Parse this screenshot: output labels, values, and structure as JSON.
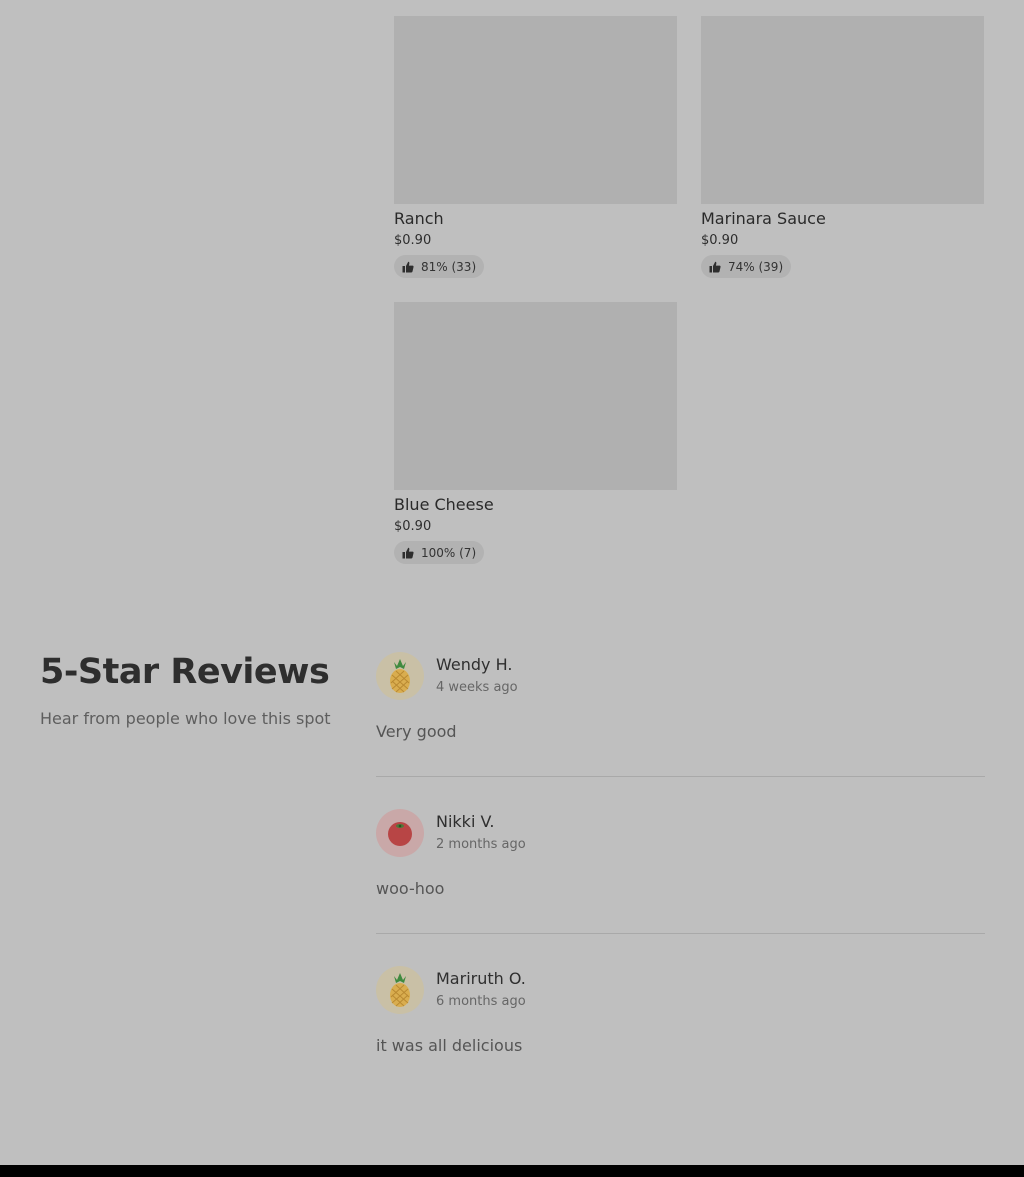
{
  "items": [
    {
      "name": "Ranch",
      "price": "$0.90",
      "rating": "81% (33)"
    },
    {
      "name": "Marinara Sauce",
      "price": "$0.90",
      "rating": "74% (39)"
    },
    {
      "name": "Blue Cheese",
      "price": "$0.90",
      "rating": "100% (7)"
    }
  ],
  "reviews_section": {
    "title": "5-Star Reviews",
    "subtitle": "Hear from people who love this spot"
  },
  "reviews": [
    {
      "name": "Wendy H.",
      "time": "4 weeks ago",
      "text": "Very good",
      "avatar_icon": "pineapple-icon"
    },
    {
      "name": "Nikki V.",
      "time": "2 months ago",
      "text": "woo-hoo",
      "avatar_icon": "tomato-icon"
    },
    {
      "name": "Mariruth O.",
      "time": "6 months ago",
      "text": "it was all delicious",
      "avatar_icon": "pineapple-icon"
    }
  ],
  "colors": {
    "background": "#bfbfbf",
    "image_placeholder": "#b0b0b0",
    "footer": "#000000"
  }
}
